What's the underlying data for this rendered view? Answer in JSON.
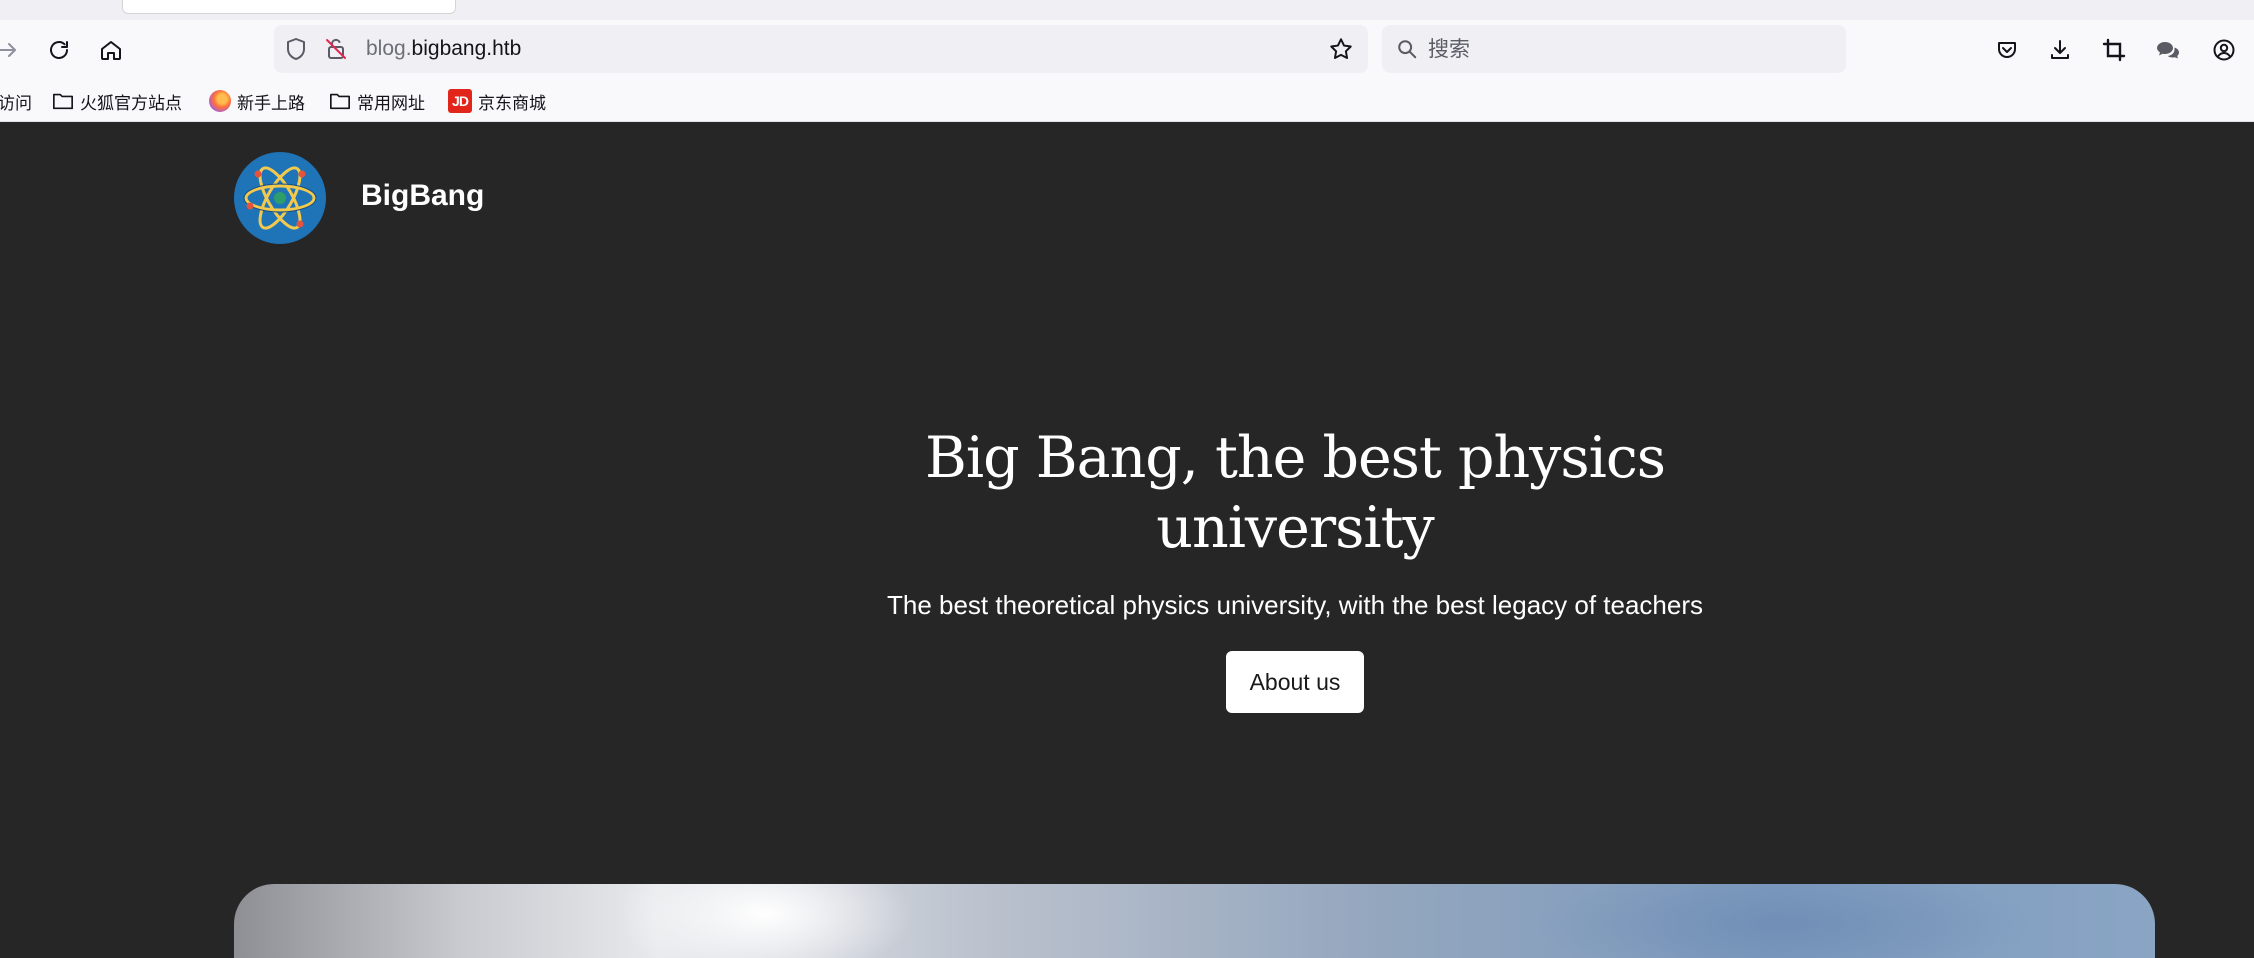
{
  "browser": {
    "url_subdomain": "blog.",
    "url_domain": "bigbang.htb",
    "search_placeholder": "搜索",
    "bookmarks": [
      {
        "label": "访问",
        "icon": "folder-icon"
      },
      {
        "label": "火狐官方站点",
        "icon": "folder-icon"
      },
      {
        "label": "新手上路",
        "icon": "firefox-icon"
      },
      {
        "label": "常用网址",
        "icon": "folder-icon"
      },
      {
        "label": "京东商城",
        "icon": "jd-icon",
        "icon_text": "JD"
      }
    ]
  },
  "site": {
    "brand": "BigBang",
    "hero_title": "Big Bang, the best physics university",
    "hero_subtitle": "The best theoretical physics university, with the best legacy of teachers",
    "about_button": "About us"
  },
  "colors": {
    "page_background": "#262626",
    "logo_background": "#1f74b7",
    "logo_atom": "#f2c94c",
    "button_background": "#ffffff"
  }
}
